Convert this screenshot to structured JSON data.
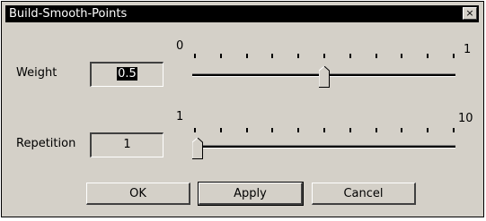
{
  "window": {
    "title": "Build-Smooth-Points",
    "close_glyph": "×"
  },
  "weight": {
    "label": "Weight",
    "value": "0.5",
    "min_label": "0",
    "max_label": "1",
    "slider_fraction": 0.5
  },
  "repetition": {
    "label": "Repetition",
    "value": "1",
    "min_label": "1",
    "max_label": "10",
    "slider_fraction": 0
  },
  "buttons": {
    "ok": "OK",
    "apply": "Apply",
    "cancel": "Cancel"
  }
}
